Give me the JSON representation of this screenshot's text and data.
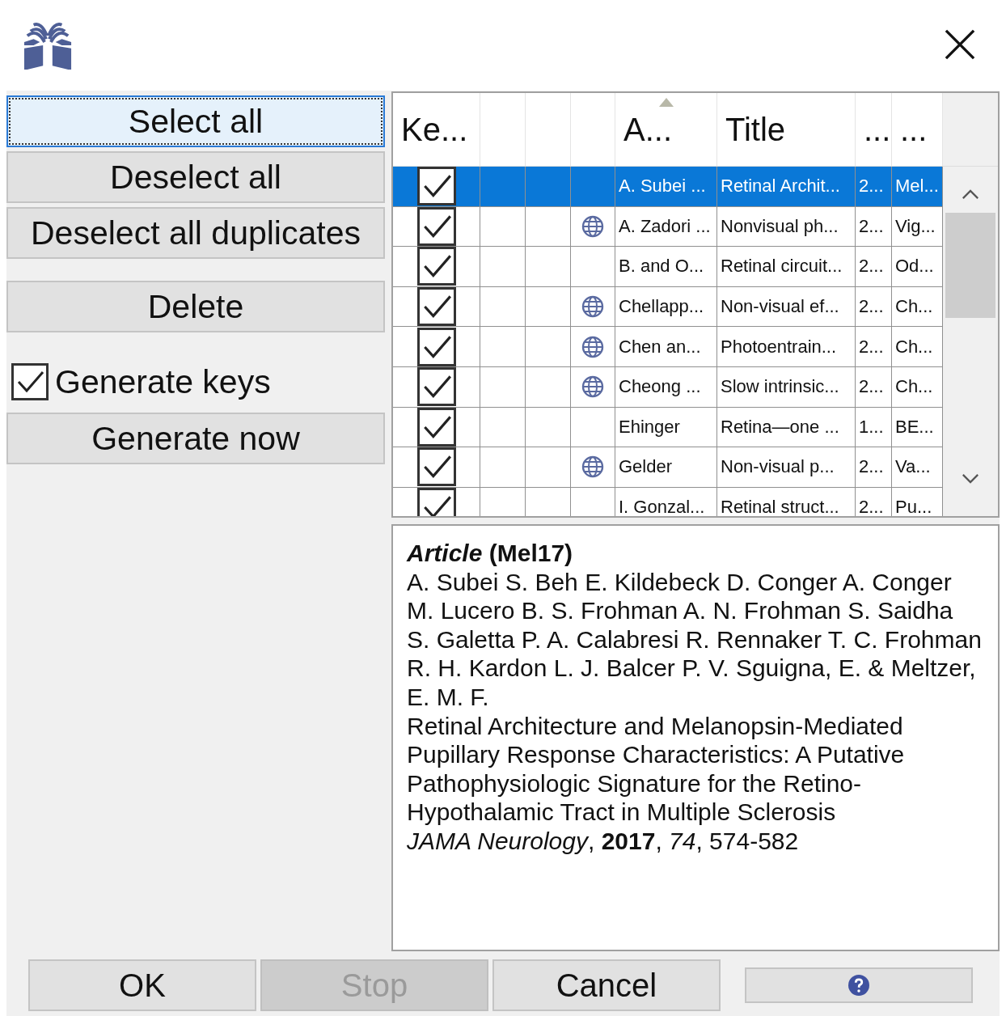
{
  "side_buttons": [
    {
      "label": "Select all",
      "focused": true
    },
    {
      "label": "Deselect all",
      "focused": false
    },
    {
      "label": "Deselect all duplicates",
      "focused": false
    },
    {
      "label": "Delete",
      "focused": false
    }
  ],
  "generate_keys": {
    "label": "Generate keys",
    "checked": true
  },
  "generate_button": {
    "label": "Generate now"
  },
  "table": {
    "columns": [
      {
        "label": "Ke...",
        "sorted": false
      },
      {},
      {},
      {},
      {
        "label": "A...",
        "sorted": true
      },
      {
        "label": "Title",
        "sorted": false
      },
      {
        "label": "...",
        "sorted": false
      },
      {
        "label": "...",
        "sorted": false
      }
    ],
    "rows": [
      {
        "selected": true,
        "checked": true,
        "web_link": false,
        "author": "A. Subei ...",
        "title": "Retinal Archit...",
        "year": "2...",
        "key": "Mel..."
      },
      {
        "selected": false,
        "checked": true,
        "web_link": true,
        "author": "A. Zadori ...",
        "title": "Nonvisual ph...",
        "year": "2...",
        "key": "Vig..."
      },
      {
        "selected": false,
        "checked": true,
        "web_link": false,
        "author": "B. and O...",
        "title": "Retinal circuit...",
        "year": "2...",
        "key": "Od..."
      },
      {
        "selected": false,
        "checked": true,
        "web_link": true,
        "author": "Chellapp...",
        "title": "Non-visual ef...",
        "year": "2...",
        "key": "Ch..."
      },
      {
        "selected": false,
        "checked": true,
        "web_link": true,
        "author": "Chen an...",
        "title": "Photoentrain...",
        "year": "2...",
        "key": "Ch..."
      },
      {
        "selected": false,
        "checked": true,
        "web_link": true,
        "author": "Cheong ...",
        "title": "Slow intrinsic...",
        "year": "2...",
        "key": "Ch..."
      },
      {
        "selected": false,
        "checked": true,
        "web_link": false,
        "author": "Ehinger",
        "title": "Retina—one ...",
        "year": "1...",
        "key": "BE..."
      },
      {
        "selected": false,
        "checked": true,
        "web_link": true,
        "author": "Gelder",
        "title": "Non-visual p...",
        "year": "2...",
        "key": "Va..."
      },
      {
        "selected": false,
        "checked": true,
        "web_link": false,
        "author": "I. Gonzal...",
        "title": "Retinal struct...",
        "year": "2...",
        "key": "Pu..."
      }
    ]
  },
  "preview": {
    "heading": "*Article* (Mel17)",
    "authors": "A. Subei S. Beh E. Kildebeck D. Conger A. Conger M. Lucero B. S. Frohman A. N. Frohman S. Saidha S. Galetta P. A. Calabresi R. Rennaker T. C. Frohman R. H. Kardon L. J. Balcer P. V. Sguigna, E. & Meltzer, E. M. F.",
    "title": "Retinal Architecture and Melanopsin-Mediated Pupillary Response Characteristics: A Putative Pathophysiologic Signature for the Retino-Hypothalamic Tract in Multiple Sclerosis",
    "source": "*JAMA Neurology*, **2017**, *74*, 574-582"
  },
  "bottom_buttons": [
    {
      "kind": "text",
      "label": "OK",
      "disabled": false
    },
    {
      "kind": "text",
      "label": "Stop",
      "disabled": true
    },
    {
      "kind": "text",
      "label": "Cancel",
      "disabled": false
    },
    {
      "kind": "help",
      "disabled": false
    }
  ]
}
